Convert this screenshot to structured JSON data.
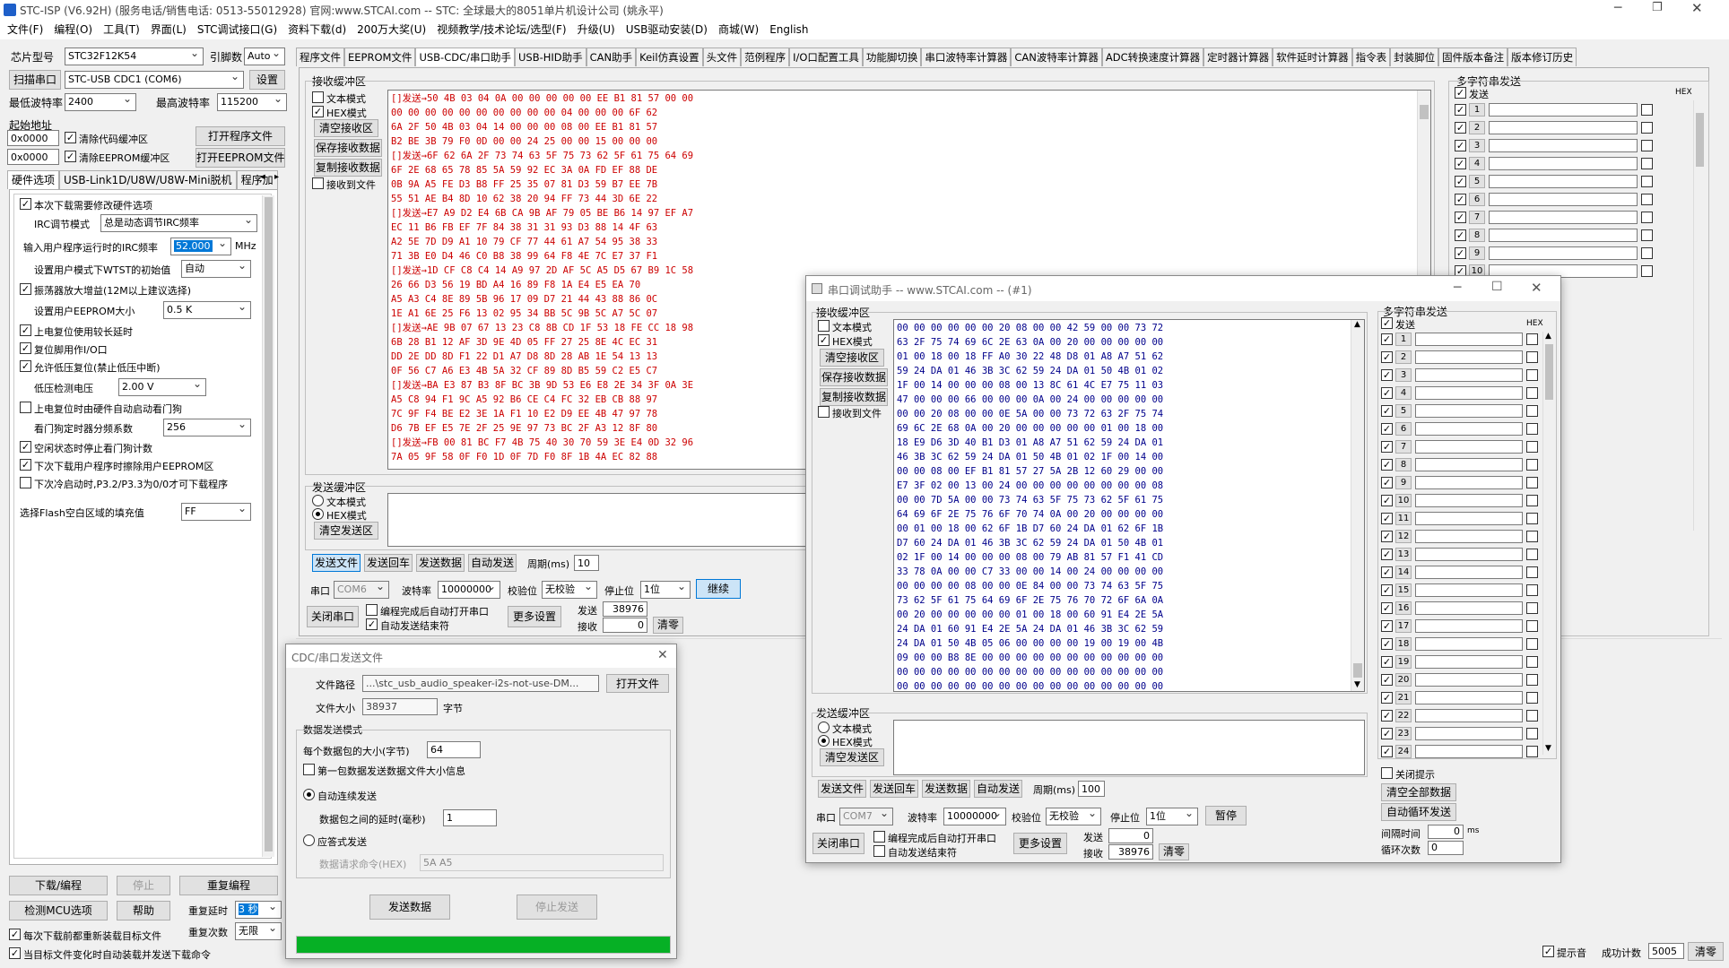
{
  "main": {
    "title": "STC-ISP (V6.92H) (服务电话/销售电话: 0513-55012928) 官网:www.STCAI.com  -- STC: 全球最大的8051单片机设计公司 (姚永平)",
    "menu": [
      "文件(F)",
      "编程(O)",
      "工具(T)",
      "界面(L)",
      "STC调试接口(G)",
      "资料下载(d)",
      "200万大奖(U)",
      "视频教学/技术论坛/选型(F)",
      "升级(U)",
      "USB驱动安装(D)",
      "商城(W)",
      "English"
    ],
    "chip_label": "芯片型号",
    "chip_value": "STC32F12K54",
    "pin_label": "引脚数",
    "pin_value": "Auto",
    "scan_label": "扫描串口",
    "port_value": "STC-USB CDC1 (COM6)",
    "settings_label": "设置",
    "min_baud_label": "最低波特率",
    "min_baud": "2400",
    "max_baud_label": "最高波特率",
    "max_baud": "115200",
    "start_addr_label": "起始地址",
    "addr1": "0x0000",
    "clear_code": "清除代码缓冲区",
    "open_prog": "打开程序文件",
    "addr2": "0x0000",
    "clear_eeprom": "清除EEPROM缓冲区",
    "open_eeprom": "打开EEPROM文件",
    "hw_tabs": [
      "硬件选项",
      "USB-Link1D/U8W/U8W-Mini脱机",
      "程序加"
    ],
    "hw_opts": {
      "o1": "本次下载需要修改硬件选项",
      "irc_mode_label": "IRC调节模式",
      "irc_mode": "总是动态调节IRC频率",
      "irc_freq_label": "输入用户程序运行时的IRC频率",
      "irc_freq": "52.000",
      "mhz": "MHz",
      "wtst_label": "设置用户模式下WTST的初始值",
      "wtst": "自动",
      "o2": "振荡器放大增益(12M以上建议选择)",
      "eeprom_size_label": "设置用户EEPROM大小",
      "eeprom_size": "0.5 K",
      "o3": "上电复位使用较长延时",
      "o4": "复位脚用作I/O口",
      "o5": "允许低压复位(禁止低压中断)",
      "lv_label": "低压检测电压",
      "lv": "2.00 V",
      "o6": "上电复位时由硬件自动启动看门狗",
      "wdt_label": "看门狗定时器分频系数",
      "wdt": "256",
      "o7": "空闲状态时停止看门狗计数",
      "o8": "下次下载用户程序时擦除用户EEPROM区",
      "o9": "下次冷启动时,P3.2/P3.3为0/0才可下载程序",
      "flash_label": "选择Flash空白区域的填充值",
      "flash": "FF"
    },
    "bottom": {
      "download": "下载/编程",
      "stop": "停止",
      "reprogram": "重复编程",
      "detect": "检测MCU选项",
      "help": "帮助",
      "delay_label": "重复延时",
      "delay": "3 秒",
      "count_label": "重复次数",
      "count": "无限",
      "c1": "每次下载前都重新装载目标文件",
      "c2": "当目标文件变化时自动装载并发送下载命令"
    },
    "top_tabs": [
      "程序文件",
      "EEPROM文件",
      "USB-CDC/串口助手",
      "USB-HID助手",
      "CAN助手",
      "Keil仿真设置",
      "头文件",
      "范例程序",
      "I/O口配置工具",
      "功能脚切换",
      "串口波特率计算器",
      "CAN波特率计算器",
      "ADC转换速度计算器",
      "定时器计算器",
      "软件延时计算器",
      "指令表",
      "封装脚位",
      "固件版本备注",
      "版本修订历史"
    ],
    "recv": {
      "title": "接收缓冲区",
      "text_mode": "文本模式",
      "hex_mode": "HEX模式",
      "clear": "清空接收区",
      "save": "保存接收数据",
      "copy": "复制接收数据",
      "to_file": "接收到文件",
      "lines": [
        "[]发送→50 4B 03 04 0A 00 00 00 00 00 EE B1 81 57 00 00",
        "00 00 00 00 00 00 00 00 00 00 04 00 00 00 6F 62",
        "6A 2F 50 4B 03 04 14 00 00 00 08 00 EE B1 81 57",
        "B2 BE 3B 79 F0 0D 00 00 24 25 00 00 15 00 00 00",
        "[]发送→6F 62 6A 2F 73 74 63 5F 75 73 62 5F 61 75 64 69",
        "6F 2E 68 65 78 85 5A 59 92 EC 3A 0A FD EF 88 DE",
        "0B 9A A5 FE D3 B8 FF 25 35 07 81 D3 59 B7 EE 7B",
        "55 51 AE B4 8D 10 62 38 20 94 FF 73 44 3D 6E 22",
        "[]发送→E7 A9 D2 E4 6B CA 9B AF 79 05 BE B6 14 97 EF A7",
        "EC 11 B6 FB EF 7F 84 38 31 31 93 D3 88 14 4F 63",
        "A2 5E 7D D9 A1 10 79 CF 77 44 61 A7 54 95 38 33",
        "71 3B E0 D4 46 C0 B8 38 99 64 F8 4E 7C E7 37 F1",
        "[]发送→1D CF C8 C4 14 A9 97 2D AF 5C A5 D5 67 B9 1C 58",
        "26 66 D3 56 19 BD A4 16 89 F8 1A E4 E5 EA 70",
        "A5 A3 C4 8E 89 5B 96 17 09 D7 21 44 43 88 86 0C",
        "1E A1 6E 25 F6 13 02 95 34 BB 5C 9B 5C A7 5C 07",
        "[]发送→AE 9B 07 67 13 23 C8 8B CD 1F 53 18 FE CC 18 98",
        "6B 28 B1 12 AF 3D 9E 4D 05 FF 27 25 8E 4C EC 31",
        "DD 2E DD 8D F1 22 D1 A7 D8 8D 28 AB 1E 54 13 13",
        "0F 56 C7 A6 E3 4B 5A 32 CF 89 8D B5 59 C2 E5 C7",
        "[]发送→BA E3 87 B3 8F BC 3B 9D 53 E6 E8 2E 34 3F 0A 3E",
        "A5 C8 94 F1 9C A5 92 B6 CE C4 FC 32 EB CB 88 97",
        "7C 9F F4 BE E2 3E 1A F1 10 E2 D9 EE 4B 47 97 78",
        "D6 7B EF E5 7E 2F 25 9E 97 73 BC 2F A3 12 8F 80",
        "[]发送→FB 00 81 BC F7 4B 75 40 30 70 59 3E E4 0D 32 96",
        "7A 05 9F 58 0F F0 1D 0F 7D F0 8F 1B 4A EC 82 88"
      ]
    },
    "send": {
      "title": "发送缓冲区",
      "text_mode": "文本模式",
      "hex_mode": "HEX模式",
      "clear": "清空发送区"
    },
    "send_btns": {
      "file": "发送文件",
      "echo": "发送回车",
      "data": "发送数据",
      "auto": "自动发送",
      "period_label": "周期(ms)",
      "period": "10"
    },
    "port_row": {
      "port_label": "串口",
      "port": "COM6",
      "baud_label": "波特率",
      "baud": "10000000",
      "parity_label": "校验位",
      "parity": "无校验",
      "stop_label": "停止位",
      "stop": "1位",
      "continue": "继续",
      "close": "关闭串口",
      "auto_open": "编程完成后自动打开串口",
      "auto_end": "自动发送结束符",
      "more": "更多设置",
      "sent_label": "发送",
      "sent": "38976",
      "recv_label": "接收",
      "recv": "0",
      "clear": "清零"
    },
    "multi": {
      "title": "多字符串发送",
      "send": "发送",
      "hex": "HEX",
      "rows": [
        "1",
        "2",
        "3",
        "4",
        "5",
        "6",
        "7",
        "8",
        "9",
        "10"
      ]
    },
    "footer": {
      "tip": "提示音",
      "count_label": "成功计数",
      "count": "5005",
      "clear": "清零"
    }
  },
  "serial": {
    "title": "串口调试助手 -- www.STCAI.com -- (#1)",
    "recv_title": "接收缓冲区",
    "text_mode": "文本模式",
    "hex_mode": "HEX模式",
    "clear": "清空接收区",
    "save": "保存接收数据",
    "copy": "复制接收数据",
    "to_file": "接收到文件",
    "lines": [
      "00 00 00 00 00 00 20 08 00 00 42 59 00 00 73 72",
      "63 2F 75 74 69 6C 2E 63 0A 00 20 00 00 00 00 00",
      "01 00 18 00 18 FF A0 30 22 48 D8 01 A8 A7 51 62",
      "59 24 DA 01 46 3B 3C 62 59 24 DA 01 50 4B 01 02",
      "1F 00 14 00 00 00 08 00 13 8C 61 4C E7 75 11 03",
      "47 00 00 00 66 00 00 00 0A 00 24 00 00 00 00 00",
      "00 00 20 08 00 00 0E 5A 00 00 73 72 63 2F 75 74",
      "69 6C 2E 68 0A 00 20 00 00 00 00 00 01 00 18 00",
      "18 E9 D6 3D 40 B1 D3 01 A8 A7 51 62 59 24 DA 01",
      "46 3B 3C 62 59 24 DA 01 50 4B 01 02 1F 00 14 00",
      "00 00 08 00 EF B1 81 57 27 5A 2B 12 60 29 00 00",
      "E7 3F 02 00 13 00 24 00 00 00 00 00 00 00 00 08",
      "00 00 7D 5A 00 00 73 74 63 5F 75 73 62 5F 61 75",
      "64 69 6F 2E 75 76 6F 70 74 0A 00 20 00 00 00 00",
      "00 01 00 18 00 62 6F 1B D7 60 24 DA 01 62 6F 1B",
      "D7 60 24 DA 01 46 3B 3C 62 59 24 DA 01 50 4B 01",
      "02 1F 00 14 00 00 00 08 00 79 AB 81 57 F1 41 CD",
      "33 78 0A 00 00 C7 33 00 00 14 00 24 00 00 00 00",
      "00 00 00 00 08 00 00 0E 84 00 00 73 74 63 5F 75",
      "73 62 5F 61 75 64 69 6F 2E 75 76 70 72 6F 6A 0A",
      "00 20 00 00 00 00 00 01 00 18 00 60 91 E4 2E 5A",
      "24 DA 01 60 91 E4 2E 5A 24 DA 01 46 3B 3C 62 59",
      "24 DA 01 50 4B 05 06 00 00 00 00 19 00 19 00 4B",
      "09 00 00 B8 8E 00 00 00 00 00 00 00 00 00 00 00",
      "00 00 00 00 00 00 00 00 00 00 00 00 00 00 00 00",
      "00 00 00 00 00 00 00 00 00 00 00 00 00 00 00 00"
    ],
    "send_title": "发送缓冲区",
    "send_clear": "清空发送区",
    "btns": {
      "file": "发送文件",
      "echo": "发送回车",
      "data": "发送数据",
      "auto": "自动发送",
      "period_label": "周期(ms)",
      "period": "100"
    },
    "port": {
      "port_label": "串口",
      "port": "COM7",
      "baud_label": "波特率",
      "baud": "10000000",
      "parity_label": "校验位",
      "parity": "无校验",
      "stop_label": "停止位",
      "stop": "1位",
      "pause": "暂停",
      "close": "关闭串口",
      "auto_open": "编程完成后自动打开串口",
      "auto_end": "自动发送结束符",
      "more": "更多设置",
      "sent_label": "发送",
      "sent": "0",
      "recv_label": "接收",
      "recv": "38976",
      "clear": "清零"
    },
    "multi": {
      "title": "多字符串发送",
      "send": "发送",
      "hex": "HEX",
      "rows": [
        "1",
        "2",
        "3",
        "4",
        "5",
        "6",
        "7",
        "8",
        "9",
        "10",
        "11",
        "12",
        "13",
        "14",
        "15",
        "16",
        "17",
        "18",
        "19",
        "20",
        "21",
        "22",
        "23",
        "24"
      ],
      "close_tip": "关闭提示",
      "clear_all": "清空全部数据",
      "auto_loop": "自动循环发送",
      "interval_label": "间隔时间",
      "interval": "0",
      "ms": "ms",
      "loop_label": "循环次数",
      "loop": "0"
    }
  },
  "cdc": {
    "title": "CDC/串口发送文件",
    "path_label": "文件路径",
    "path": "...\\stc_usb_audio_speaker-i2s-not-use-DM...",
    "open": "打开文件",
    "size_label": "文件大小",
    "size": "38937",
    "bytes": "字节",
    "mode_title": "数据发送模式",
    "pkt_label": "每个数据包的大小(字节)",
    "pkt": "64",
    "first_pkt": "第一包数据发送数据文件大小信息",
    "auto": "自动连续发送",
    "delay_label": "数据包之间的延时(毫秒)",
    "delay": "1",
    "reply": "应答式发送",
    "req_label": "数据请求命令(HEX)",
    "req": "5A A5",
    "send": "发送数据",
    "stop": "停止发送",
    "progress": 1.0
  }
}
